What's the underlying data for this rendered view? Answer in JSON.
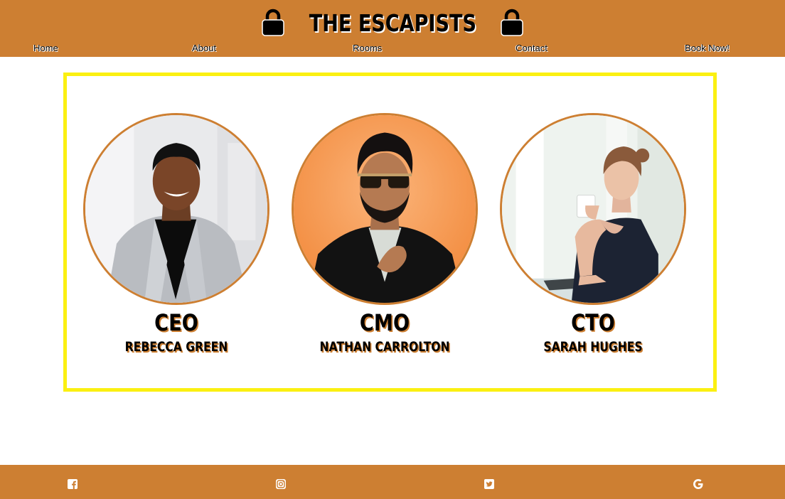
{
  "header": {
    "title": "THE ESCAPISTS",
    "left_icon": "lock-icon",
    "right_icon": "lock-icon",
    "background": "#cd7f32"
  },
  "nav": {
    "items": [
      {
        "label": "Home"
      },
      {
        "label": "About"
      },
      {
        "label": "Rooms"
      },
      {
        "label": "Contact"
      },
      {
        "label": "Book Now!"
      }
    ]
  },
  "team": {
    "frame_color": "#fbf011",
    "members": [
      {
        "role": "CEO",
        "name": "REBECCA GREEN",
        "photo": "ceo-photo"
      },
      {
        "role": "CMO",
        "name": "NATHAN CARROLTON",
        "photo": "cmo-photo"
      },
      {
        "role": "CTO",
        "name": "SARAH HUGHES",
        "photo": "cto-photo"
      }
    ]
  },
  "footer": {
    "background": "#cd7f32",
    "icons": [
      "facebook-icon",
      "instagram-icon",
      "twitter-icon",
      "google-icon"
    ]
  }
}
